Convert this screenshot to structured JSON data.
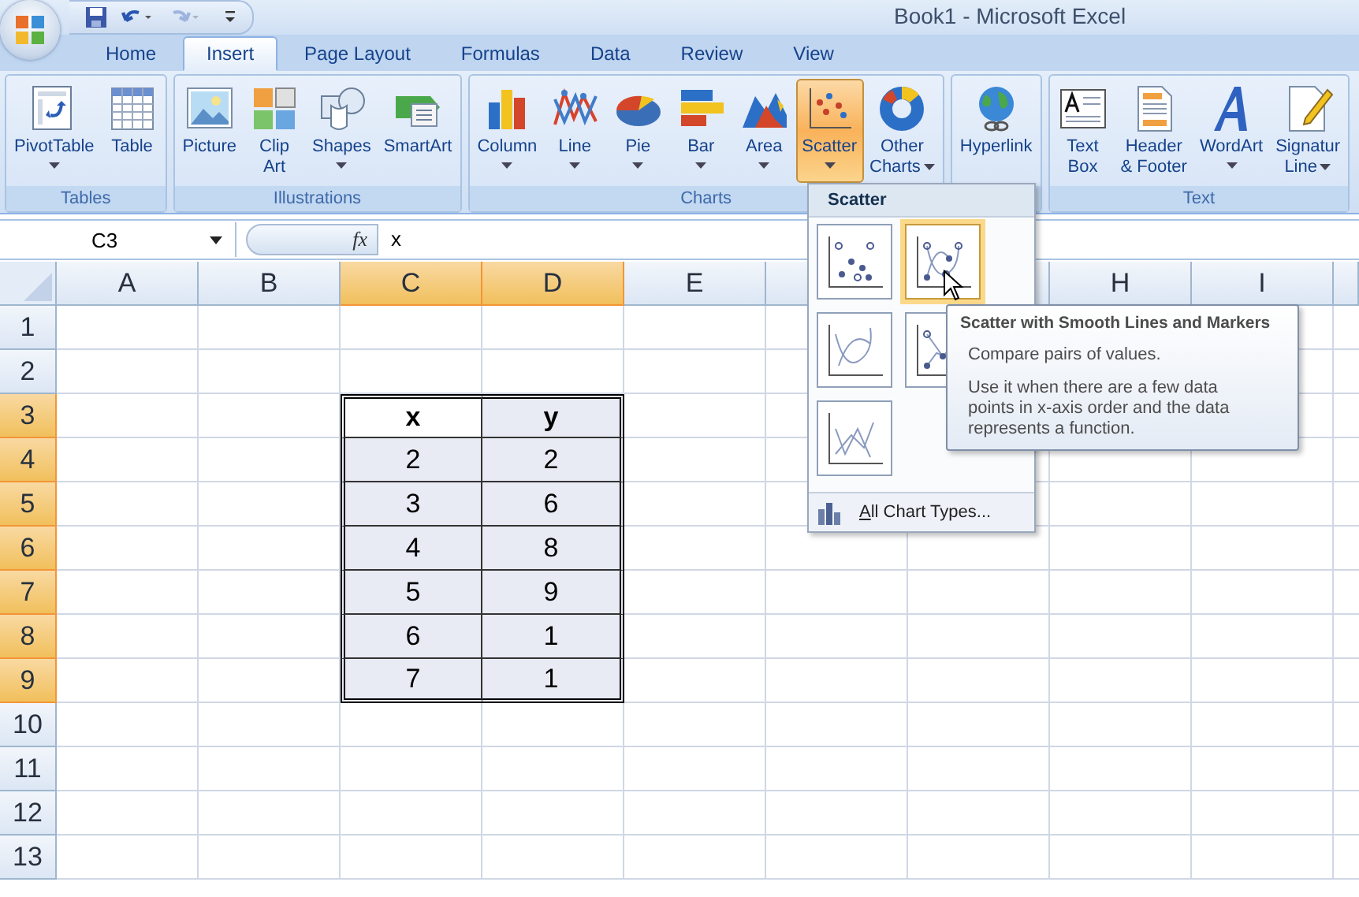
{
  "window": {
    "title": "Book1 - Microsoft Excel"
  },
  "quick_access_toolbar": [
    {
      "kind": "save",
      "disabled": false
    },
    {
      "kind": "undo",
      "disabled": false
    },
    {
      "kind": "redo",
      "disabled": true
    },
    {
      "kind": "customize",
      "disabled": false
    }
  ],
  "tabs": [
    {
      "label": "Home",
      "selected": false
    },
    {
      "label": "Insert",
      "selected": true
    },
    {
      "label": "Page Layout",
      "selected": false
    },
    {
      "label": "Formulas",
      "selected": false
    },
    {
      "label": "Data",
      "selected": false
    },
    {
      "label": "Review",
      "selected": false
    },
    {
      "label": "View",
      "selected": false
    }
  ],
  "ribbon": {
    "groups": [
      {
        "label": "Tables",
        "buttons": [
          {
            "label": "PivotTable",
            "dropdown": true,
            "selected": false
          },
          {
            "label": "Table",
            "dropdown": false,
            "selected": false
          }
        ]
      },
      {
        "label": "Illustrations",
        "buttons": [
          {
            "label": "Picture",
            "dropdown": false,
            "selected": false
          },
          {
            "label": "Clip\nArt",
            "dropdown": false,
            "selected": false
          },
          {
            "label": "Shapes",
            "dropdown": true,
            "selected": false
          },
          {
            "label": "SmartArt",
            "dropdown": false,
            "selected": false
          }
        ]
      },
      {
        "label": "Charts",
        "buttons": [
          {
            "label": "Column",
            "dropdown": true,
            "selected": false
          },
          {
            "label": "Line",
            "dropdown": true,
            "selected": false
          },
          {
            "label": "Pie",
            "dropdown": true,
            "selected": false
          },
          {
            "label": "Bar",
            "dropdown": true,
            "selected": false
          },
          {
            "label": "Area",
            "dropdown": true,
            "selected": false
          },
          {
            "label": "Scatter",
            "dropdown": true,
            "selected": true
          },
          {
            "label": "Other\nCharts",
            "dropdown": true,
            "selected": false
          }
        ]
      },
      {
        "buttons": [
          {
            "label": "Hyperlink",
            "dropdown": false,
            "selected": false
          }
        ]
      },
      {
        "label": "Text",
        "buttons": [
          {
            "label": "Text\nBox",
            "dropdown": false,
            "selected": false
          },
          {
            "label": "Header\n& Footer",
            "dropdown": false,
            "selected": false
          },
          {
            "label": "WordArt",
            "dropdown": true,
            "selected": false
          },
          {
            "label": "Signatur\nLine",
            "dropdown": true,
            "selected": false
          }
        ]
      }
    ]
  },
  "formula_bar": {
    "name_box": "C3",
    "function_label": "fx",
    "formula": "x"
  },
  "sheet": {
    "columns": [
      {
        "label": "A",
        "selected": false
      },
      {
        "label": "B",
        "selected": false
      },
      {
        "label": "C",
        "selected": true
      },
      {
        "label": "D",
        "selected": true
      },
      {
        "label": "E",
        "selected": false
      },
      {
        "selected": false
      },
      {
        "selected": false
      },
      {
        "label": "H",
        "selected": false
      },
      {
        "label": "I",
        "selected": false
      },
      {
        "selected": false
      }
    ],
    "rows": [
      {
        "label": "1",
        "selected": false
      },
      {
        "label": "2",
        "selected": false
      },
      {
        "label": "3",
        "selected": true
      },
      {
        "label": "4",
        "selected": true
      },
      {
        "label": "5",
        "selected": true
      },
      {
        "label": "6",
        "selected": true
      },
      {
        "label": "7",
        "selected": true
      },
      {
        "label": "8",
        "selected": true
      },
      {
        "label": "9",
        "selected": true
      },
      {
        "label": "10",
        "selected": false
      },
      {
        "label": "11",
        "selected": false
      },
      {
        "label": "12",
        "selected": false
      },
      {
        "label": "13",
        "selected": false
      }
    ],
    "table": {
      "header": [
        "x",
        "y"
      ],
      "rows": [
        [
          "2",
          "2"
        ],
        [
          "3",
          "6"
        ],
        [
          "4",
          "8"
        ],
        [
          "5",
          "9"
        ],
        [
          "6",
          "1"
        ],
        [
          "7",
          "1"
        ]
      ]
    }
  },
  "chart_dropdown": {
    "title": "Scatter",
    "options": [
      {
        "selected": false
      },
      {
        "selected": true
      },
      {
        "selected": false
      },
      {
        "selected": false
      },
      {
        "selected": false
      }
    ],
    "footer": "All Chart Types..."
  },
  "tooltip": {
    "title": "Scatter with Smooth Lines and Markers",
    "paragraphs": [
      "Compare pairs of values.",
      "Use it when there are a few data points in x-axis order and the data represents a function."
    ]
  }
}
